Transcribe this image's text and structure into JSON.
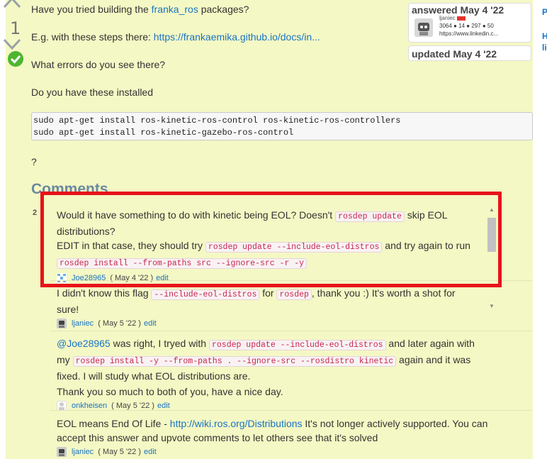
{
  "answer": {
    "vote_count": "1",
    "p1_prefix": "Have you tried building the ",
    "p1_link": "franka_ros",
    "p1_suffix": " packages?",
    "p2_prefix": "E.g. with these steps there: ",
    "p2_link": "https://frankaemika.github.io/docs/in...",
    "p3": "What errors do you see there?",
    "p4": "Do you have these installed",
    "code_lines": [
      "sudo apt-get install ros-kinetic-ros-control ros-kinetic-ros-controllers",
      "sudo apt-get install ros-kinetic-gazebo-ros-control"
    ],
    "p5": "?"
  },
  "answered_card": {
    "title": "answered May 4 '22",
    "user": "ljaniec",
    "karma": "3064 ● 14 ● 297 ● 50",
    "url": "https://www.linkedin.c..."
  },
  "updated_card": {
    "title": "updated May 4 '22"
  },
  "sidebar_links": [
    "P",
    "H",
    "li"
  ],
  "comments_title": "Comments",
  "comment_count": "2",
  "comments": [
    {
      "l1_a": "Would it have something to do with kinetic being EOL? Doesn't ",
      "l1_code": "rosdep update",
      "l1_b": " skip EOL",
      "l2": "distributions?",
      "l3_a": "EDIT in that case, they should try ",
      "l3_code": "rosdep update --include-eol-distros",
      "l3_b": " and try again to run",
      "l4_code": "rosdep install --from-paths src --ignore-src -r -y",
      "user": "Joe28965",
      "date": "( May 4 '22 )",
      "edit": "edit"
    },
    {
      "l1_a": "I didn't know this flag ",
      "l1_code": "--include-eol-distros",
      "l1_b": " for ",
      "l1_code2": "rosdep",
      "l1_c": ", thank you :) It's worth a shot for",
      "l2": "sure!",
      "user": "ljaniec",
      "date": "( May 5 '22 )",
      "edit": "edit"
    },
    {
      "l1_mention": "@Joe28965",
      "l1_a": " was right, I tryed with ",
      "l1_code": "rosdep update --include-eol-distros",
      "l1_b": " and later again with",
      "l2_a": "my ",
      "l2_code": "rosdep install -y --from-paths . --ignore-src --rosdistro kinetic",
      "l2_b": " again and it was",
      "l3": "fixed. I will study what EOL distributions are.",
      "l4": "Thank you so much to both of you, have a nice day.",
      "user": "onkheisen",
      "date": "( May 5 '22 )",
      "edit": "edit"
    },
    {
      "l1_a": "EOL means End Of Life - ",
      "l1_link": "http://wiki.ros.org/Distributions",
      "l1_b": " It's not longer actively supported. You can",
      "l2": "accept this answer and upvote comments to let others see that it's solved",
      "user": "ljaniec",
      "date": "( May 5 '22 )",
      "edit": "edit"
    }
  ]
}
